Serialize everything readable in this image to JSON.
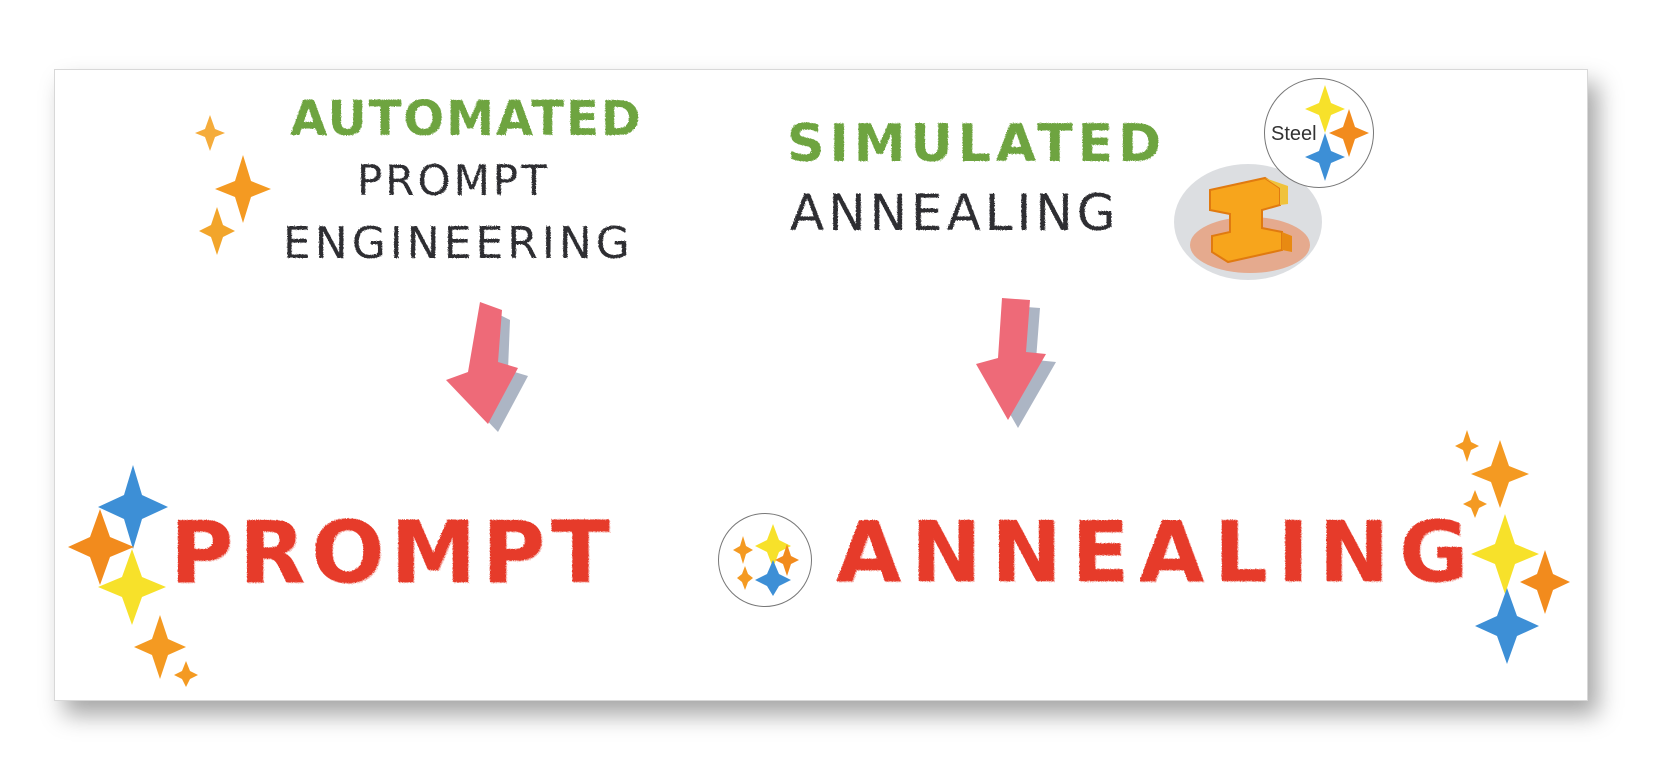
{
  "top_left": {
    "line1": "AUTOMATED",
    "line2": "PROMPT",
    "line3": "ENGINEERING"
  },
  "top_right": {
    "line1": "SIMULATED",
    "line2": "ANNEALING",
    "logo_text": "Steel"
  },
  "bottom": {
    "word_left": "PROMPT",
    "word_right": "ANNEALING"
  },
  "colors": {
    "green": "#6ea43f",
    "dark": "#2e2e33",
    "red": "#e63a2a",
    "arrow": "#ee6a78",
    "yellow": "#f7e12a",
    "orange": "#f28b1d",
    "blue": "#3d8fd6"
  },
  "icons": [
    "sparkle-icon",
    "arrow-down-icon",
    "steel-logo-icon",
    "steel-ingot-icon"
  ]
}
